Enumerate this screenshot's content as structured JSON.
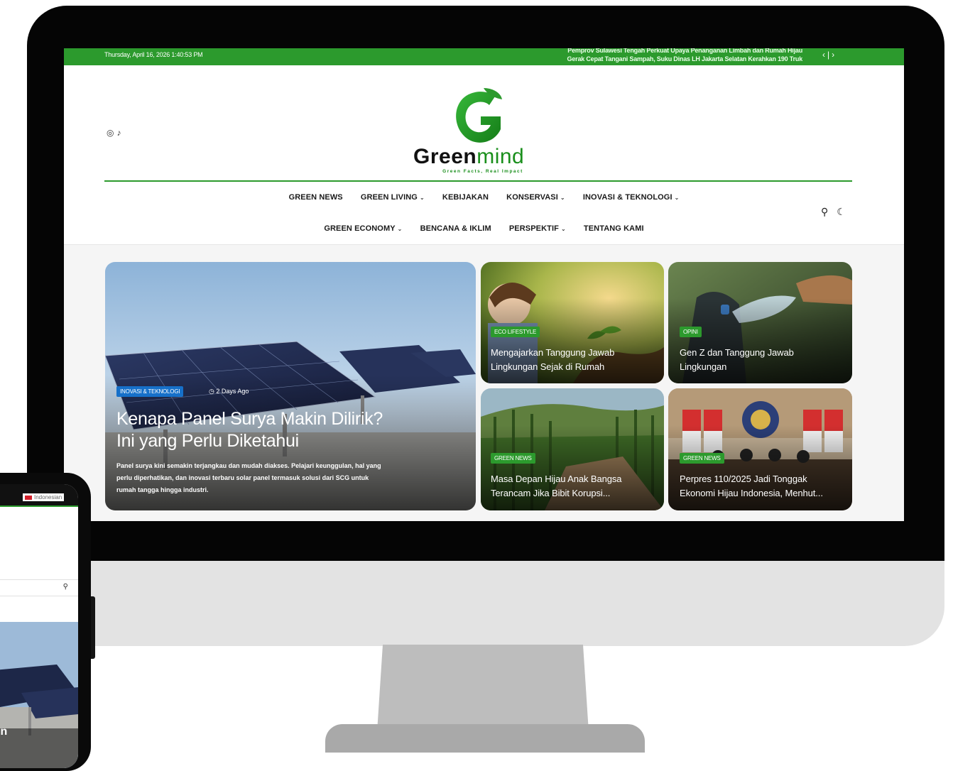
{
  "topbar": {
    "datetime": "Thursday, April 16, 2026  1:40:53 PM",
    "ticker_line1": "Pemprov Sulawesi Tengah Perkuat Upaya Penanganan Limbah dan Rumah Hijau",
    "ticker_line2": "Gerak Cepat Tangani Sampah, Suku Dinas LH Jakarta Selatan Kerahkan 190 Truk",
    "prev": "‹",
    "divider": "|",
    "next": "›"
  },
  "brand": {
    "logo_bold": "Green",
    "logo_light": "mind",
    "tagline": "Green Facts, Real Impact"
  },
  "nav": {
    "row1": [
      {
        "label": "GREEN NEWS",
        "dropdown": false
      },
      {
        "label": "GREEN LIVING",
        "dropdown": true
      },
      {
        "label": "KEBIJAKAN",
        "dropdown": false
      },
      {
        "label": "KONSERVASI",
        "dropdown": true
      },
      {
        "label": "INOVASI & TEKNOLOGI",
        "dropdown": true
      }
    ],
    "row2": [
      {
        "label": "GREEN ECONOMY",
        "dropdown": true
      },
      {
        "label": "BENCANA & IKLIM",
        "dropdown": false
      },
      {
        "label": "PERSPEKTIF",
        "dropdown": true
      },
      {
        "label": "TENTANG KAMI",
        "dropdown": false
      }
    ],
    "chevron": "⌄"
  },
  "icons": {
    "instagram": "◎",
    "tiktok": "♪",
    "search": "⚲",
    "dark_mode": "☾"
  },
  "hero": {
    "category": "INOVASI & TEKNOLOGI",
    "clock": "◷",
    "time_ago": "2 Days Ago",
    "title_line1": "Kenapa Panel Surya Makin Dilirik?",
    "title_line2": "Ini yang Perlu Diketahui",
    "excerpt_line1": "Panel surya kini semakin terjangkau dan mudah diakses. Pelajari keunggulan, hal yang",
    "excerpt_line2": "perlu diperhatikan, dan inovasi terbaru solar panel termasuk solusi dari SCG untuk",
    "excerpt_line3": "rumah tangga hingga industri."
  },
  "cards": [
    {
      "category": "ECO LIFESTYLE",
      "title_line1": "Mengajarkan Tanggung Jawab",
      "title_line2": "Lingkungan Sejak di Rumah"
    },
    {
      "category": "OPINI",
      "title_line1": "Gen Z dan Tanggung Jawab",
      "title_line2": "Lingkungan"
    },
    {
      "category": "GREEN NEWS",
      "title_line1": "Masa Depan Hijau Anak Bangsa",
      "title_line2": "Terancam Jika Bibit Korupsi..."
    },
    {
      "category": "GREEN NEWS",
      "title_line1": "Perpres 110/2025 Jadi Tonggak",
      "title_line2": "Ekonomi Hijau Indonesia, Menhut..."
    }
  ],
  "phone": {
    "language": "Indonesian",
    "hero_fragment": "in"
  },
  "colors": {
    "brand_green": "#2c9a2d",
    "category_blue": "#1670c9",
    "bezel": "#050505"
  }
}
